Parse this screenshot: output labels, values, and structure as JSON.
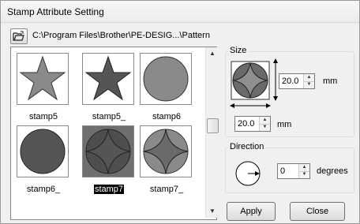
{
  "window": {
    "title": "Stamp Attribute Setting"
  },
  "path": {
    "text": "C:\\Program Files\\Brother\\PE-DESIG...\\Pattern"
  },
  "stamps": [
    {
      "label": "stamp5",
      "shape": "star",
      "fill": "#8a8a8a",
      "selected": false
    },
    {
      "label": "stamp5_",
      "shape": "star",
      "fill": "#555555",
      "selected": false
    },
    {
      "label": "stamp6",
      "shape": "circle",
      "fill": "#8a8a8a",
      "selected": false
    },
    {
      "label": "stamp6_",
      "shape": "circle",
      "fill": "#555555",
      "selected": false
    },
    {
      "label": "stamp7",
      "shape": "astroid",
      "fill": "#555555",
      "selected": true
    },
    {
      "label": "stamp7_",
      "shape": "astroid",
      "fill": "#8a8a8a",
      "selected": false
    }
  ],
  "size": {
    "group_label": "Size",
    "height_value": "20.0",
    "width_value": "20.0",
    "unit": "mm"
  },
  "direction": {
    "group_label": "Direction",
    "value": "0",
    "unit": "degrees"
  },
  "buttons": {
    "apply": "Apply",
    "close": "Close"
  }
}
